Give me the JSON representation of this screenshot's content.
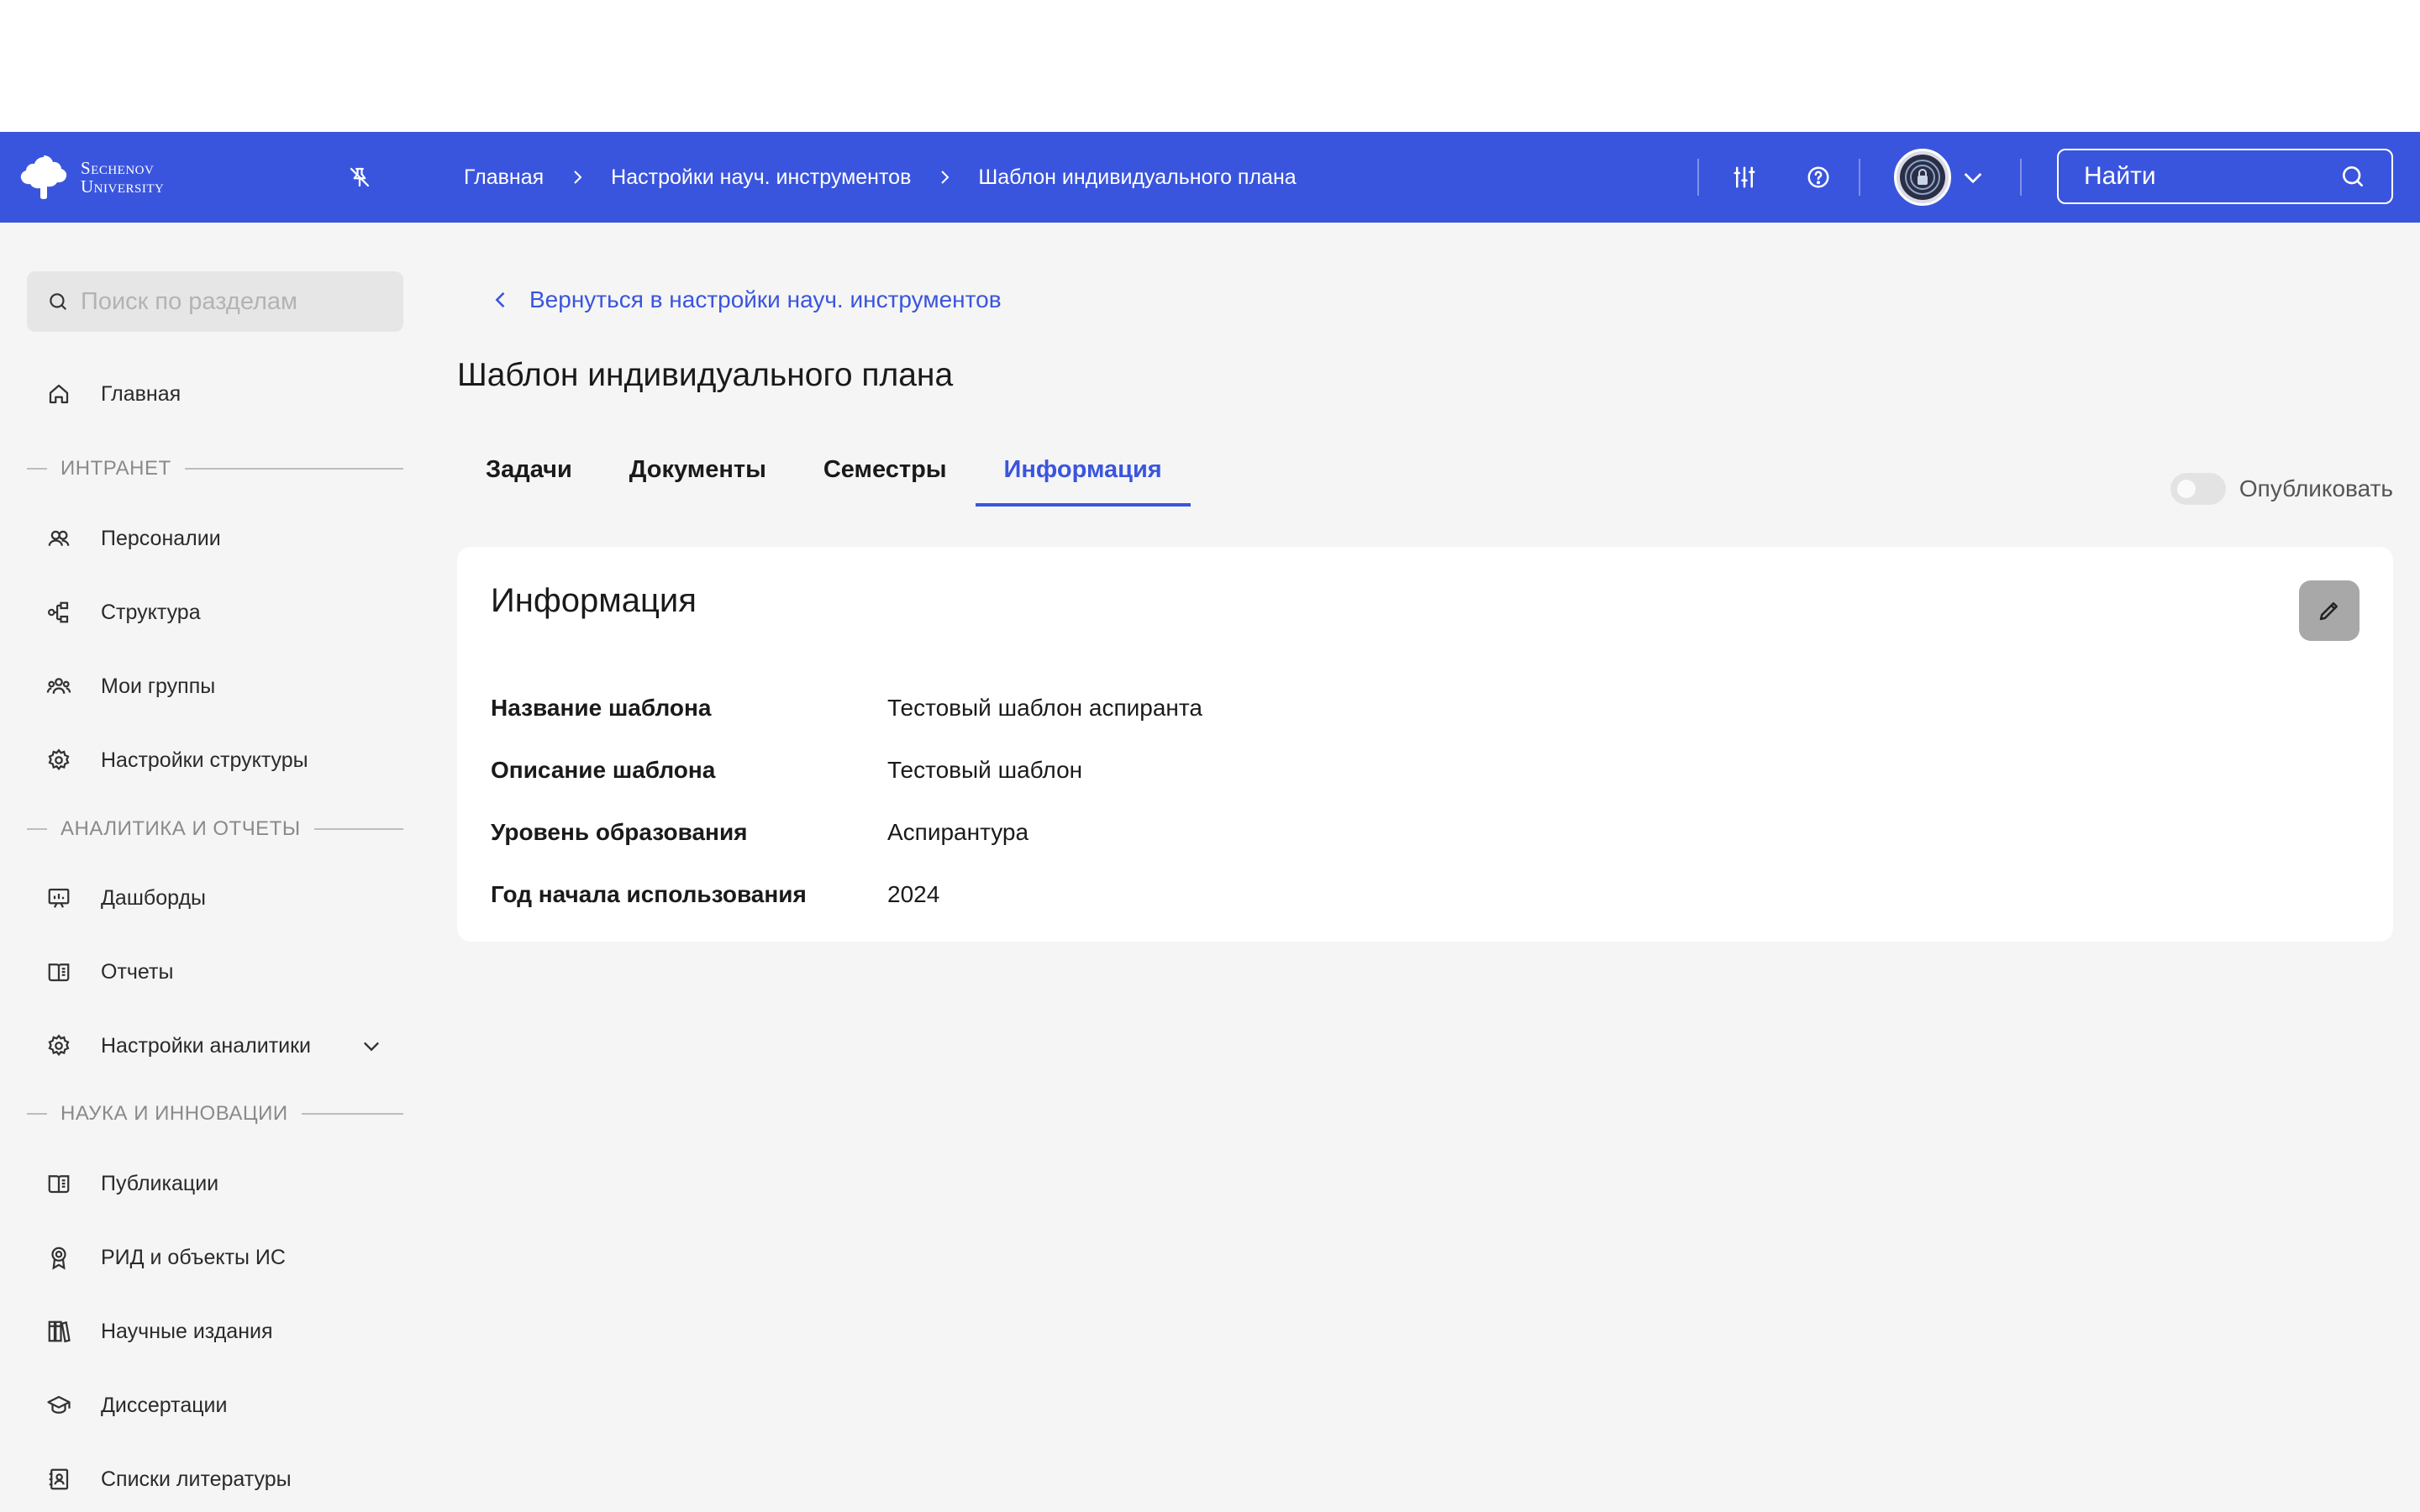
{
  "header": {
    "logo_line1": "Sechenov",
    "logo_line2": "University",
    "breadcrumbs": [
      "Главная",
      "Настройки науч. инструментов",
      "Шаблон индивидуального плана"
    ],
    "search_placeholder": "Найти",
    "accent": "#3a55dd"
  },
  "sidebar": {
    "search_placeholder": "Поиск по разделам",
    "home": "Главная",
    "section_intranet": "ИНТРАНЕТ",
    "persons": "Персоналии",
    "structure": "Структура",
    "my_groups": "Мои группы",
    "structure_settings": "Настройки структуры",
    "section_analytics": "АНАЛИТИКА И ОТЧЕТЫ",
    "dashboards": "Дашборды",
    "reports": "Отчеты",
    "analytics_settings": "Настройки аналитики",
    "section_science": "НАУКА И ИННОВАЦИИ",
    "publications": "Публикации",
    "rid": "РИД и объекты ИС",
    "journals": "Научные издания",
    "dissertations": "Диссертации",
    "literature": "Списки литературы"
  },
  "main": {
    "back_link": "Вернуться в настройки науч. инструментов",
    "title": "Шаблон индивидуального плана",
    "tabs": [
      "Задачи",
      "Документы",
      "Семестры",
      "Информация"
    ],
    "active_tab": "Информация",
    "publish_label": "Опубликовать",
    "publish_on": false,
    "card": {
      "title": "Информация",
      "rows": [
        {
          "label": "Название шаблона",
          "value": "Тестовый шаблон аспиранта"
        },
        {
          "label": "Описание шаблона",
          "value": "Тестовый шаблон"
        },
        {
          "label": "Уровень образования",
          "value": "Аспирантура"
        },
        {
          "label": "Год начала использования",
          "value": "2024"
        }
      ]
    }
  }
}
